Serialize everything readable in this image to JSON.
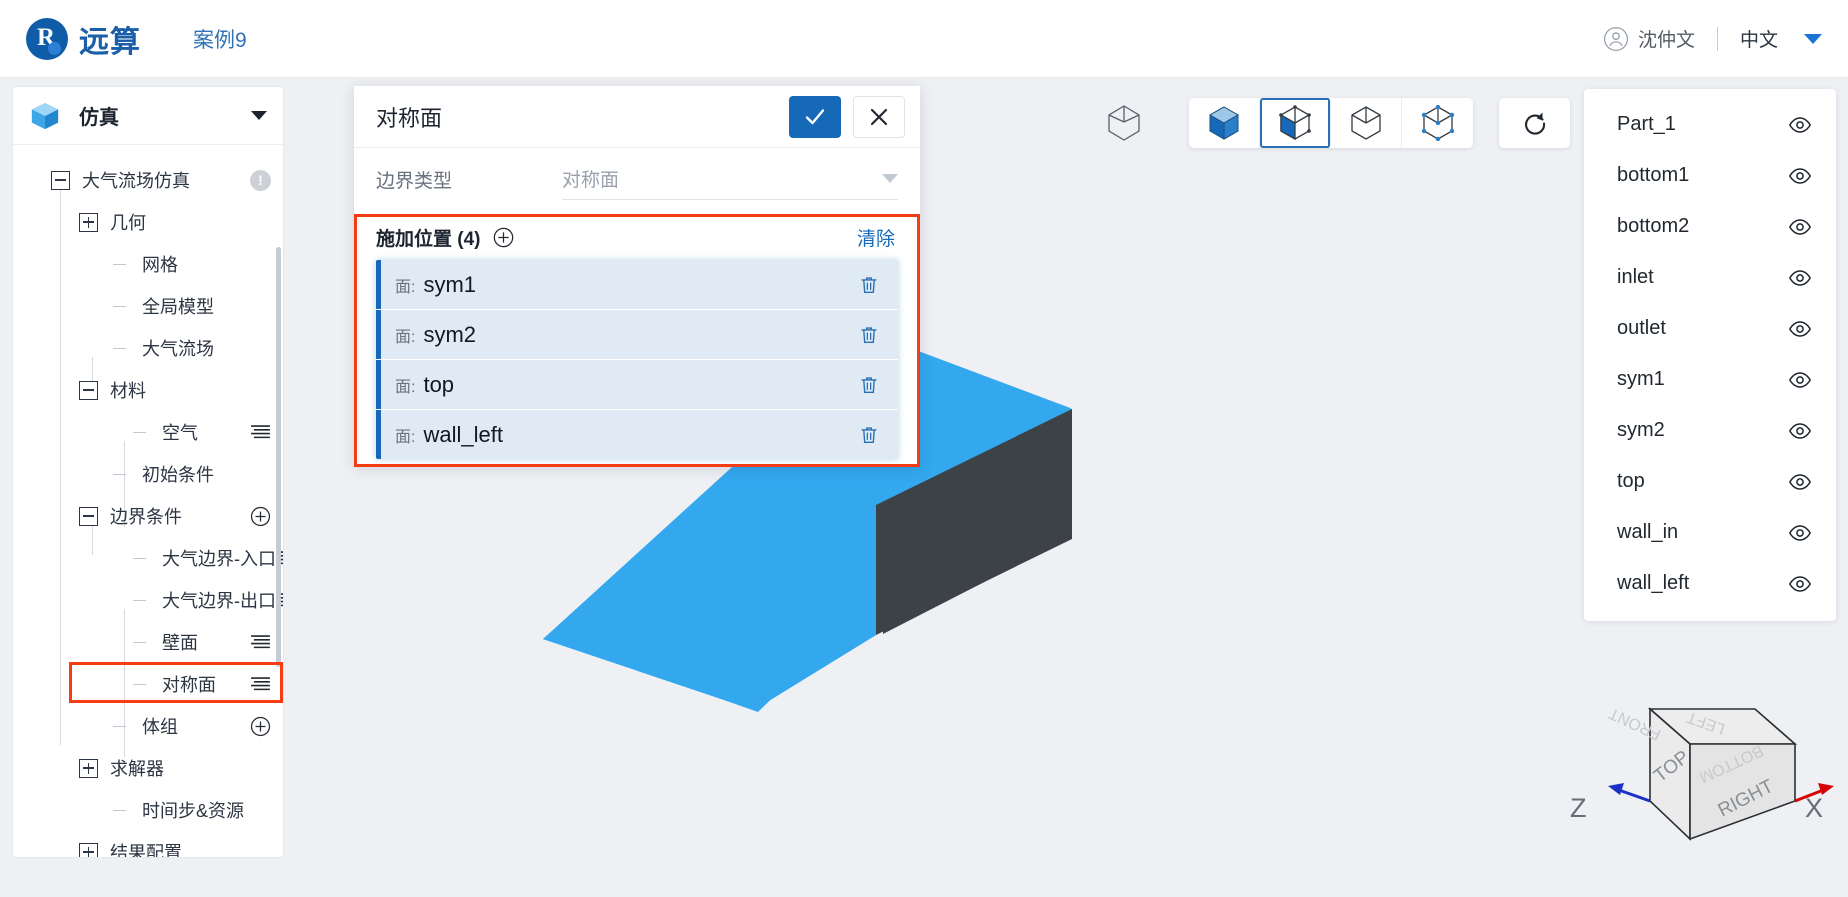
{
  "topbar": {
    "brand_logo_icon": "yuansuan-logo-icon",
    "brand_name": "远算",
    "case_title": "案例9",
    "user_icon": "user-avatar-icon",
    "user_name": "沈仲文",
    "language": "中文",
    "language_caret_icon": "chevron-down-icon"
  },
  "sidebar": {
    "header": {
      "icon": "blue-cube-icon",
      "title": "仿真",
      "caret_icon": "chevron-down-icon"
    },
    "tree": [
      {
        "label": "大气流场仿真",
        "level": 0,
        "toggle": "minus",
        "tail": "warn"
      },
      {
        "label": "几何",
        "level": 1,
        "toggle": "plus",
        "tail": ""
      },
      {
        "label": "网格",
        "level": 2,
        "toggle": "leaf",
        "tail": ""
      },
      {
        "label": "全局模型",
        "level": 2,
        "toggle": "leaf",
        "tail": ""
      },
      {
        "label": "大气流场",
        "level": 2,
        "toggle": "leaf",
        "tail": ""
      },
      {
        "label": "材料",
        "level": 1,
        "toggle": "minus",
        "tail": ""
      },
      {
        "label": "空气",
        "level": 3,
        "toggle": "leaf",
        "tail": "menu"
      },
      {
        "label": "初始条件",
        "level": 2,
        "toggle": "leaf",
        "tail": ""
      },
      {
        "label": "边界条件",
        "level": 1,
        "toggle": "minus",
        "tail": "plus"
      },
      {
        "label": "大气边界-入口",
        "level": 3,
        "toggle": "leaf",
        "tail": "menu"
      },
      {
        "label": "大气边界-出口",
        "level": 3,
        "toggle": "leaf",
        "tail": "menu"
      },
      {
        "label": "壁面",
        "level": 3,
        "toggle": "leaf",
        "tail": "menu"
      },
      {
        "label": "对称面",
        "level": 3,
        "toggle": "leaf",
        "tail": "menu",
        "selected": true,
        "highlighted": true
      },
      {
        "label": "体组",
        "level": 2,
        "toggle": "leaf",
        "tail": "plus"
      },
      {
        "label": "求解器",
        "level": 1,
        "toggle": "plus",
        "tail": ""
      },
      {
        "label": "时间步&资源",
        "level": 2,
        "toggle": "leaf",
        "tail": ""
      },
      {
        "label": "结果配置",
        "level": 1,
        "toggle": "plus",
        "tail": ""
      }
    ]
  },
  "dialog": {
    "title": "对称面",
    "confirm_icon": "check-icon",
    "cancel_icon": "close-icon",
    "field": {
      "label": "边界类型",
      "value": "对称面",
      "caret_icon": "chevron-down-icon"
    },
    "picks": {
      "title": "施加位置 (4)",
      "add_icon": "plus-circle-icon",
      "clear_label": "清除",
      "delete_icon": "trash-icon",
      "items": [
        {
          "prefix": "面:",
          "name": "sym1"
        },
        {
          "prefix": "面:",
          "name": "sym2"
        },
        {
          "prefix": "面:",
          "name": "top"
        },
        {
          "prefix": "面:",
          "name": "wall_left"
        }
      ]
    }
  },
  "viewport_toolbar": {
    "standalone_icon": "wireframe-cube-icon",
    "buttons": [
      {
        "icon": "solid-cube-icon",
        "active": false
      },
      {
        "icon": "face-select-cube-icon",
        "active": true
      },
      {
        "icon": "edge-select-cube-icon",
        "active": false
      },
      {
        "icon": "vertex-select-cube-icon",
        "active": false
      }
    ],
    "reset_icon": "reset-view-icon"
  },
  "right_panel": {
    "eye_icon": "eye-icon",
    "items": [
      {
        "name": "Part_1"
      },
      {
        "name": "bottom1"
      },
      {
        "name": "bottom2"
      },
      {
        "name": "inlet"
      },
      {
        "name": "outlet"
      },
      {
        "name": "sym1"
      },
      {
        "name": "sym2"
      },
      {
        "name": "top"
      },
      {
        "name": "wall_in"
      },
      {
        "name": "wall_left"
      }
    ]
  },
  "axis_cube": {
    "face_top": "TOP",
    "face_right": "RIGHT",
    "face_front": "FRONT",
    "face_left": "LEFT",
    "face_bottom": "BOTTOM",
    "axis_z": "Z",
    "axis_x": "X"
  },
  "colors": {
    "accent": "#1669b8",
    "brand": "#1a5fa8",
    "highlight_red": "#f63c12",
    "model_blue": "#33a8ef",
    "model_dark": "#3d4246",
    "pick_row_bg": "#e0eaf5"
  }
}
